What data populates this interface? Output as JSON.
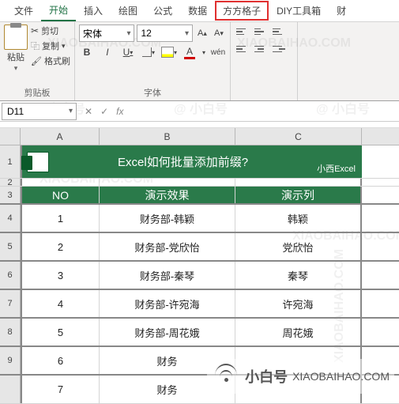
{
  "tabs": {
    "file": "文件",
    "home": "开始",
    "insert": "插入",
    "draw": "绘图",
    "formula": "公式",
    "data": "数据",
    "fangfang": "方方格子",
    "diy": "DIY工具箱",
    "extra": "财"
  },
  "clipboard": {
    "paste": "粘贴",
    "cut": "剪切",
    "copy": "复制",
    "format": "格式刷",
    "group": "剪贴板"
  },
  "font": {
    "name": "宋体",
    "size": "12",
    "group": "字体"
  },
  "namebox": "D11",
  "col": {
    "a": "A",
    "b": "B",
    "c": "C"
  },
  "banner": {
    "title": "Excel如何批量添加前缀?",
    "author": "小西Excel"
  },
  "headers": {
    "no": "NO",
    "effect": "演示效果",
    "col": "演示列"
  },
  "rows": [
    {
      "no": "1",
      "b": "财务部-韩颖",
      "c": "韩颖"
    },
    {
      "no": "2",
      "b": "财务部-党欣怡",
      "c": "党欣怡"
    },
    {
      "no": "3",
      "b": "财务部-秦琴",
      "c": "秦琴"
    },
    {
      "no": "4",
      "b": "财务部-许宛海",
      "c": "许宛海"
    },
    {
      "no": "5",
      "b": "财务部-周花娥",
      "c": "周花娥"
    },
    {
      "no": "6",
      "b": "财务",
      "c": ""
    },
    {
      "no": "7",
      "b": "财务",
      "c": ""
    }
  ],
  "overlay": {
    "brand": "小白号",
    "url": "XIAOBAIHAO.COM"
  }
}
